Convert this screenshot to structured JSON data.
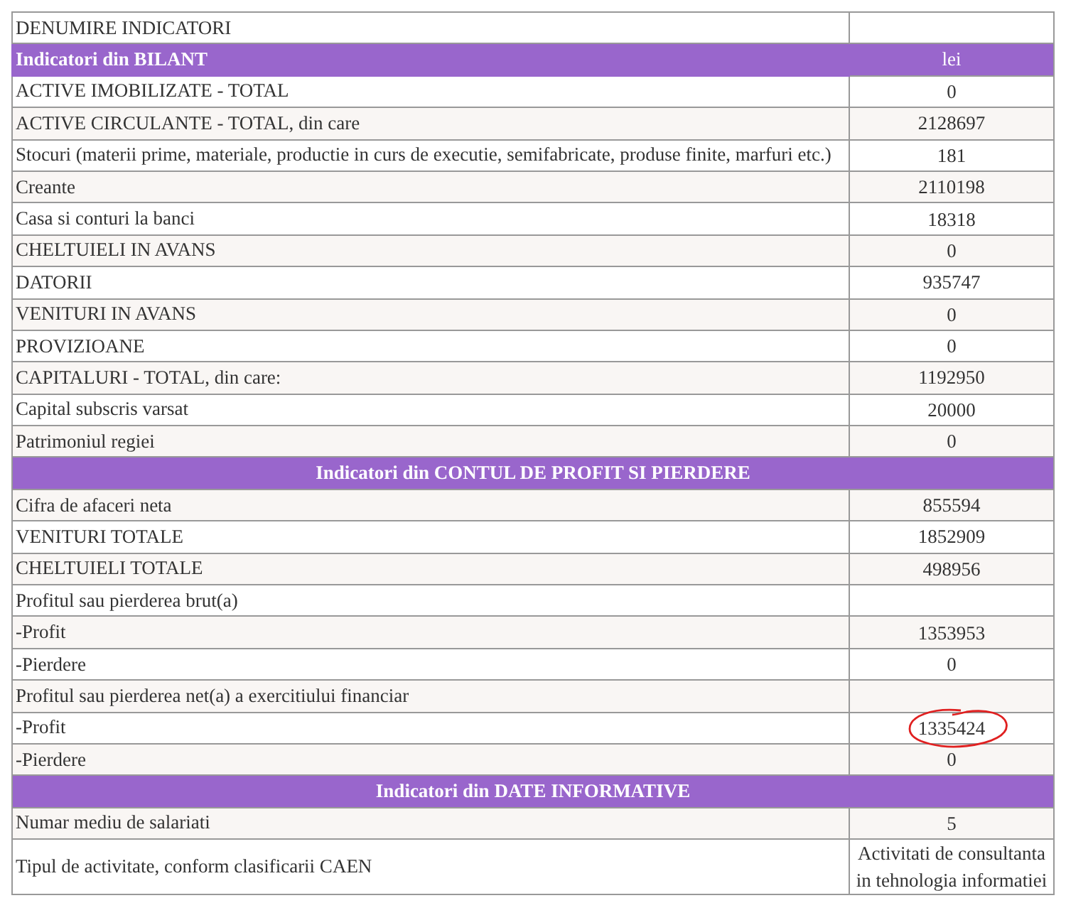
{
  "rows": [
    {
      "kind": "row",
      "label": "DENUMIRE INDICATORI",
      "value": ""
    },
    {
      "kind": "section",
      "label": "Indicatori din BILANT",
      "value": "lei"
    },
    {
      "kind": "row",
      "label": "ACTIVE IMOBILIZATE - TOTAL",
      "value": "0"
    },
    {
      "kind": "row",
      "label": "ACTIVE CIRCULANTE - TOTAL, din care",
      "value": "2128697"
    },
    {
      "kind": "row",
      "label": "Stocuri (materii prime, materiale, productie in curs de executie, semifabricate, produse finite, marfuri etc.)",
      "value": "181"
    },
    {
      "kind": "row",
      "label": "Creante",
      "value": "2110198"
    },
    {
      "kind": "row",
      "label": "Casa si conturi la banci",
      "value": "18318"
    },
    {
      "kind": "row",
      "label": "CHELTUIELI IN AVANS",
      "value": "0"
    },
    {
      "kind": "row",
      "label": "DATORII",
      "value": "935747"
    },
    {
      "kind": "row",
      "label": "VENITURI IN AVANS",
      "value": "0"
    },
    {
      "kind": "row",
      "label": "PROVIZIOANE",
      "value": "0"
    },
    {
      "kind": "row",
      "label": "CAPITALURI - TOTAL, din care:",
      "value": "1192950"
    },
    {
      "kind": "row",
      "label": "Capital subscris varsat",
      "value": "20000"
    },
    {
      "kind": "row",
      "label": "Patrimoniul regiei",
      "value": "0"
    },
    {
      "kind": "banner",
      "label": "Indicatori din CONTUL DE PROFIT SI PIERDERE"
    },
    {
      "kind": "row",
      "label": "Cifra de afaceri neta",
      "value": "855594"
    },
    {
      "kind": "row",
      "label": "VENITURI TOTALE",
      "value": "1852909"
    },
    {
      "kind": "row",
      "label": "CHELTUIELI TOTALE",
      "value": "498956"
    },
    {
      "kind": "row",
      "label": "Profitul sau pierderea brut(a)",
      "value": ""
    },
    {
      "kind": "row",
      "label": "-Profit",
      "value": "1353953"
    },
    {
      "kind": "row",
      "label": "-Pierdere",
      "value": "0"
    },
    {
      "kind": "row",
      "label": "Profitul sau pierderea net(a) a exercitiului financiar",
      "value": ""
    },
    {
      "kind": "row",
      "label": "-Profit",
      "value": "1335424",
      "circled": true
    },
    {
      "kind": "row",
      "label": "-Pierdere",
      "value": "0"
    },
    {
      "kind": "banner",
      "label": "Indicatori din DATE INFORMATIVE"
    },
    {
      "kind": "row",
      "label": "Numar mediu de salariati",
      "value": "5"
    },
    {
      "kind": "row",
      "label": "Tipul de activitate, conform clasificarii CAEN",
      "value": "Activitati de consultanta in tehnologia informatiei"
    }
  ]
}
